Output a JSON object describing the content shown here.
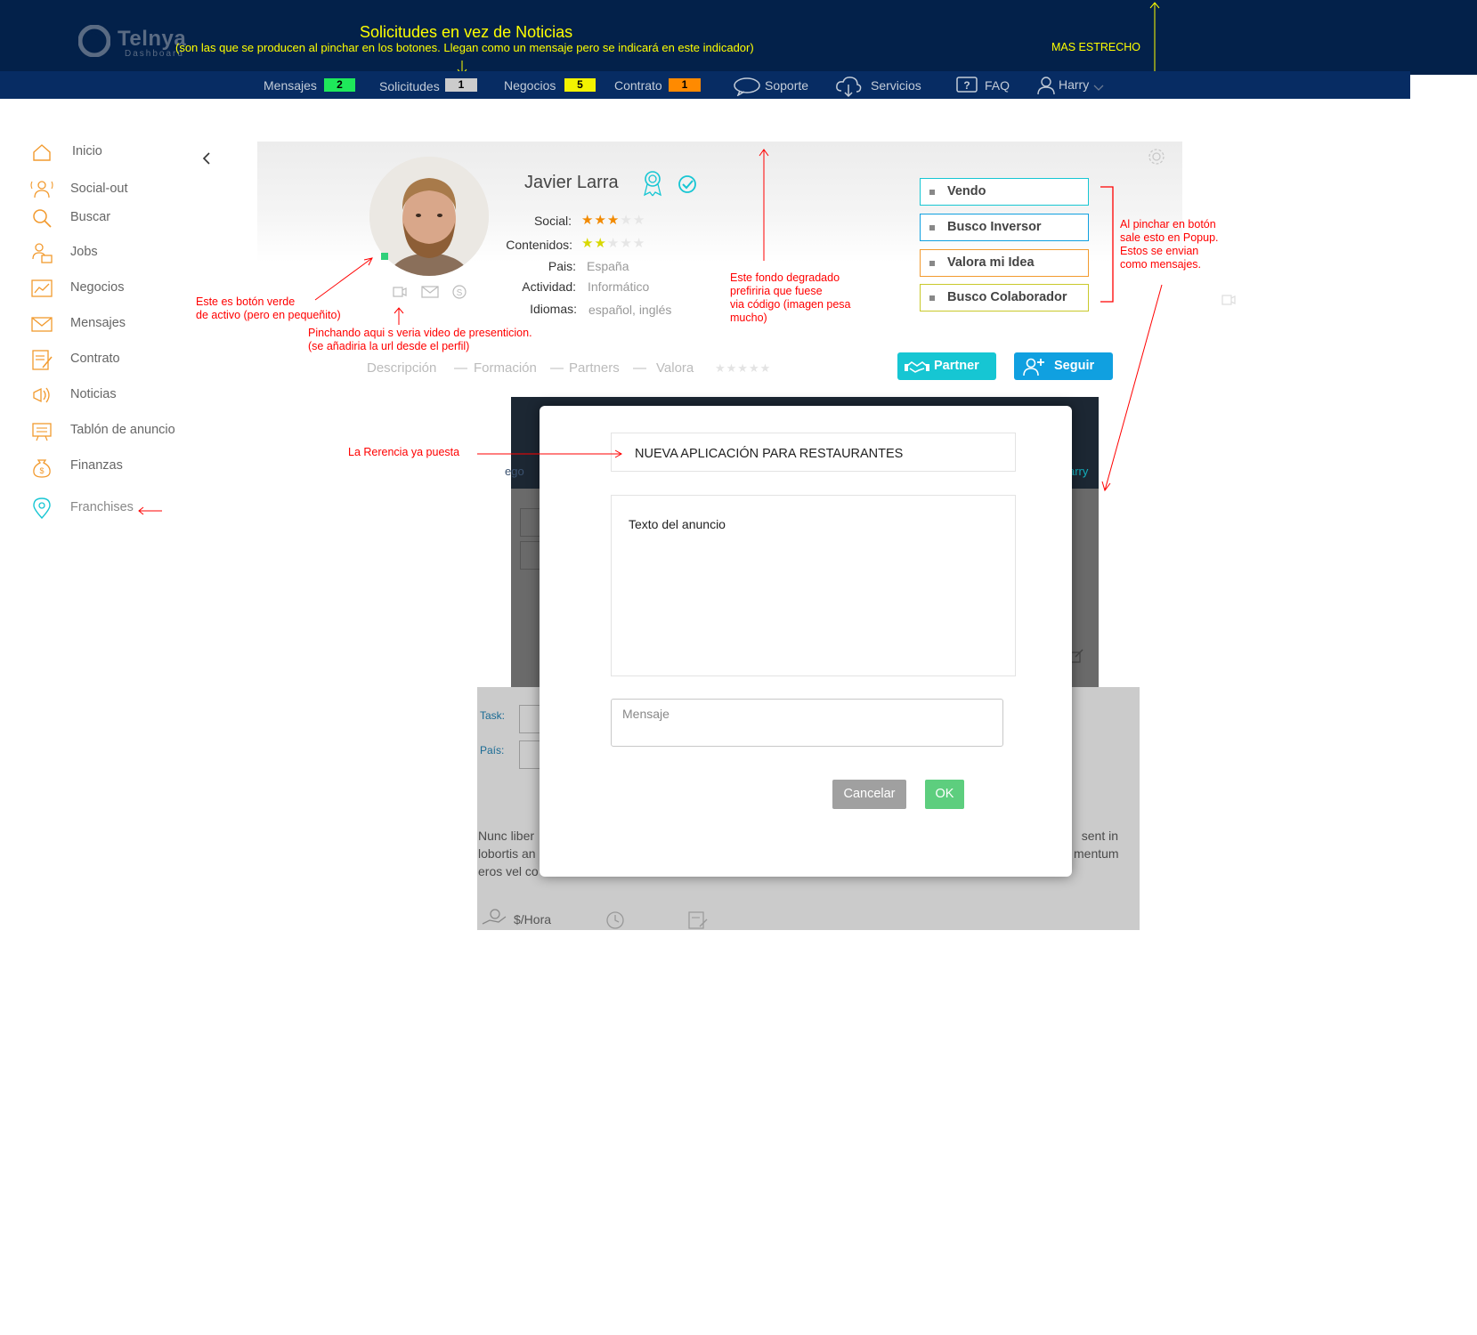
{
  "header": {
    "logo_text": "Telnya",
    "logo_sub": "Dashboard",
    "annotation_title": "Solicitudes en vez de Noticias",
    "annotation_sub": "(son las que se producen al pinchar en  los botones. Llegan como un mensaje pero se indicará en este indicador)",
    "annotation_narrow": "MAS ESTRECHO"
  },
  "nav": {
    "mensajes": {
      "label": "Mensajes",
      "count": "2",
      "color": "#1ee85a"
    },
    "solicitudes": {
      "label": "Solicitudes",
      "count": "1",
      "color": "#cccccc"
    },
    "negocios": {
      "label": "Negocios",
      "count": "5",
      "color": "#f2f200"
    },
    "contrato": {
      "label": "Contrato",
      "count": "1",
      "color": "#ff8a00"
    },
    "soporte": "Soporte",
    "servicios": "Servicios",
    "faq": "FAQ",
    "user": "Harry"
  },
  "sidebar": {
    "items": [
      {
        "label": "Inicio",
        "icon": "home-icon"
      },
      {
        "label": "Social-out",
        "icon": "social-icon"
      },
      {
        "label": "Buscar",
        "icon": "search-icon"
      },
      {
        "label": "Jobs",
        "icon": "jobs-icon"
      },
      {
        "label": "Negocios",
        "icon": "chart-icon"
      },
      {
        "label": "Mensajes",
        "icon": "mail-icon"
      },
      {
        "label": "Contrato",
        "icon": "contract-icon"
      },
      {
        "label": "Noticias",
        "icon": "news-icon"
      },
      {
        "label": "Tablón de anuncio",
        "icon": "board-icon"
      },
      {
        "label": "Finanzas",
        "icon": "money-bag-icon"
      },
      {
        "label": "Franchises",
        "icon": "location-pin-icon"
      }
    ]
  },
  "profile": {
    "name": "Javier Larra",
    "social_label": "Social:",
    "social_rating": 3,
    "contenidos_label": "Contenidos:",
    "contenidos_rating": 2,
    "pais_label": "Pais:",
    "pais_value": "España",
    "actividad_label": "Actividad:",
    "actividad_value": "Informático",
    "idiomas_label": "Idiomas:",
    "idiomas_value": "español, inglés"
  },
  "actions": [
    {
      "label": "Vendo",
      "color": "#16c6d3"
    },
    {
      "label": "Busco Inversor",
      "color": "#10a0e0"
    },
    {
      "label": "Valora mi Idea",
      "color": "#f29a2e"
    },
    {
      "label": "Busco Colaborador",
      "color": "#c9c92a"
    }
  ],
  "tabs": {
    "descripcion": "Descripción",
    "formacion": "Formación",
    "partners": "Partners",
    "valora": "Valora",
    "sep": "—"
  },
  "buttons": {
    "partner": "Partner",
    "seguir": "Seguir"
  },
  "annotations": {
    "active_button": [
      "Este es botón verde",
      "de activo (pero en pequeñito)"
    ],
    "video": [
      "Pinchando aqui s veria video de presenticion.",
      "(se añadiria la url desde el perfil)"
    ],
    "gradient": [
      "Este fondo degradado",
      "prefiriria que fuese",
      "via código (imagen pesa",
      "mucho)"
    ],
    "popup": [
      "Al pinchar en botón",
      "sale esto en Popup.",
      "Estos se envian",
      "como mensajes."
    ],
    "reference": "La Rerencia ya puesta"
  },
  "background_snippets": {
    "nego": "ego",
    "harry": "arry",
    "task": "Task:",
    "pais": "País:",
    "lorem_left": [
      "Nunc liber",
      "lobortis an",
      "eros vel co"
    ],
    "lorem_right": [
      "sent in",
      "mentum"
    ],
    "hora": "$/Hora"
  },
  "modal": {
    "reference": "NUEVA APLICACIÓN PARA RESTAURANTES",
    "text": "Texto del anuncio",
    "message_placeholder": "Mensaje",
    "cancel": "Cancelar",
    "ok": "OK"
  }
}
